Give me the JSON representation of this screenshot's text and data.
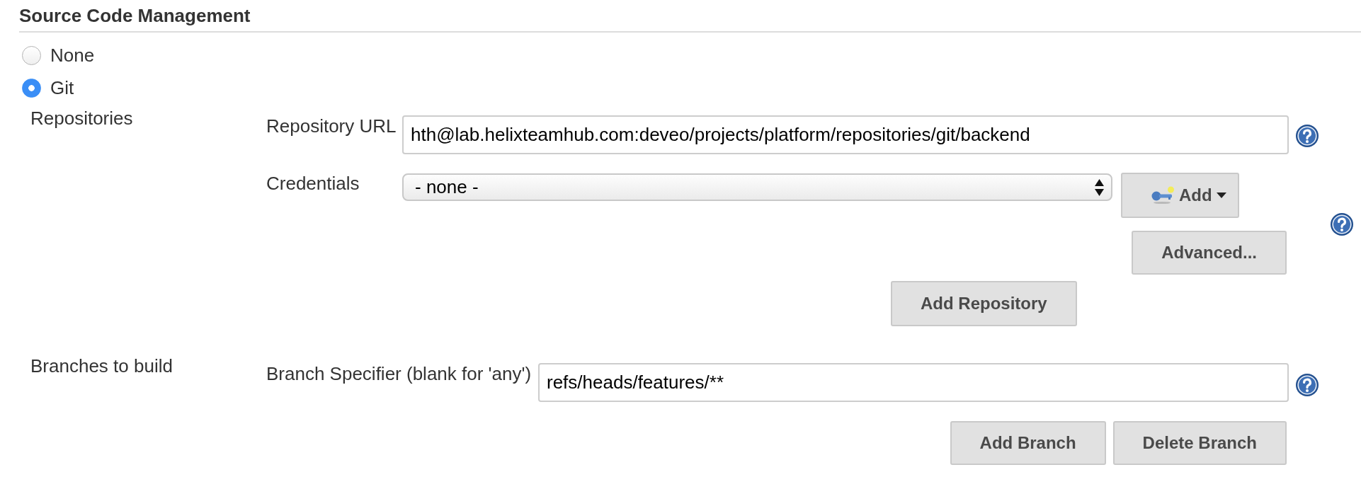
{
  "section": {
    "title": "Source Code Management"
  },
  "scm_options": [
    {
      "label": "None",
      "selected": false
    },
    {
      "label": "Git",
      "selected": true
    }
  ],
  "repositories": {
    "label": "Repositories",
    "repository_url": {
      "label": "Repository URL",
      "value": "hth@lab.helixteamhub.com:deveo/projects/platform/repositories/git/backend"
    },
    "credentials": {
      "label": "Credentials",
      "value": "- none -"
    },
    "add_button": "Add",
    "advanced_button": "Advanced...",
    "add_repository_button": "Add Repository"
  },
  "branches": {
    "label": "Branches to build",
    "branch_specifier": {
      "label": "Branch Specifier (blank for 'any')",
      "value": "refs/heads/features/**"
    },
    "buttons": [
      "Add Branch",
      "Delete Branch"
    ]
  }
}
